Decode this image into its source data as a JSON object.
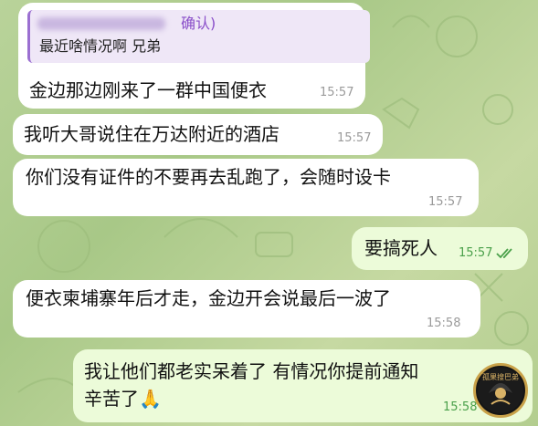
{
  "chat": {
    "reply_preview": {
      "name_suffix": "确认)",
      "text": "最近啥情况啊 兄弟"
    },
    "messages": [
      {
        "text": "金边那边刚来了一群中国便衣",
        "time": "15:57"
      },
      {
        "text": "我听大哥说住在万达附近的酒店",
        "time": "15:57"
      },
      {
        "text": "你们没有证件的不要再去乱跑了，会随时设卡",
        "time": "15:57"
      },
      {
        "text": "要搞死人",
        "time": "15:57",
        "read_icon": "double-check-icon"
      },
      {
        "text": "便衣柬埔寨年后才走，金边开会说最后一波了",
        "time": "15:58"
      },
      {
        "text": "我让他们都老实呆着了 有情况你提前通知",
        "text2": "辛苦了🙏",
        "time": "15:58"
      }
    ]
  },
  "colors": {
    "incoming_bubble": "#ffffff",
    "outgoing_bubble": "#ecfbd9",
    "reply_accent": "#9b6fd1",
    "read_check": "#4aa04a"
  },
  "watermark": {
    "icon": "channel-logo-icon",
    "text": "孤果搜巴弟"
  }
}
